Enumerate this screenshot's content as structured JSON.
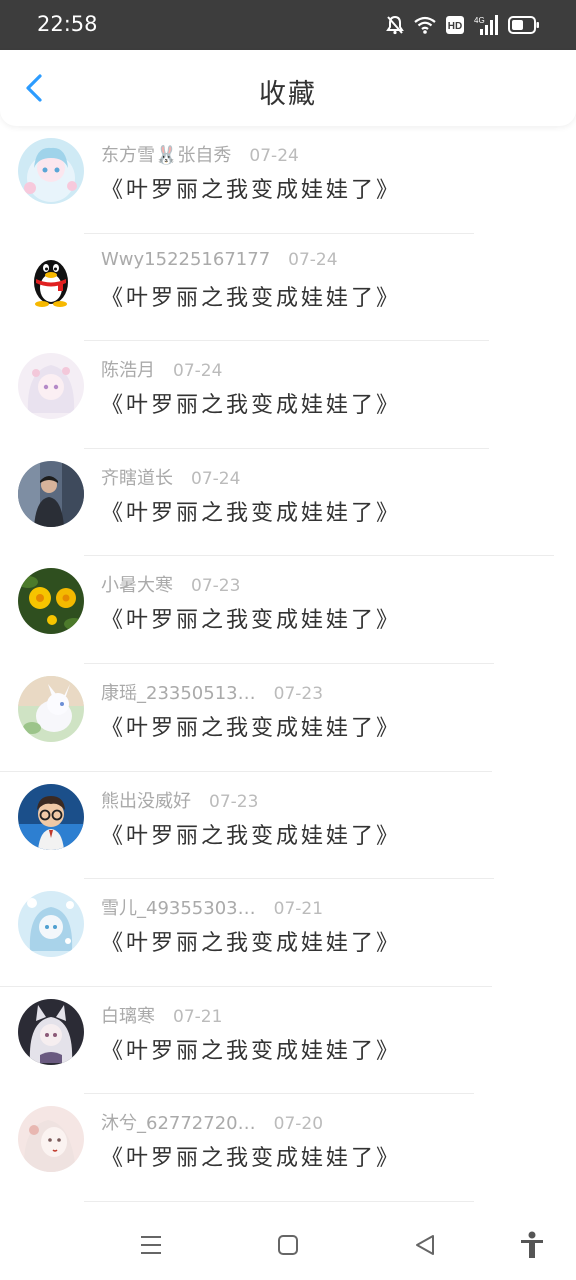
{
  "status_bar": {
    "time": "22:58",
    "hd_badge": "HD",
    "network": "4G"
  },
  "header": {
    "title": "收藏"
  },
  "items": [
    {
      "name": "东方雪🐰张自秀",
      "date": "07-24",
      "content": "《叶罗丽之我变成娃娃了》",
      "avatar": "anime-girl-blue"
    },
    {
      "name": "Wwy15225167177",
      "date": "07-24",
      "content": "《叶罗丽之我变成娃娃了》",
      "avatar": "penguin"
    },
    {
      "name": "陈浩月",
      "date": "07-24",
      "content": "《叶罗丽之我变成娃娃了》",
      "avatar": "anime-girl-pink"
    },
    {
      "name": "齐瞎道长",
      "date": "07-24",
      "content": "《叶罗丽之我变成娃娃了》",
      "avatar": "photo-boy"
    },
    {
      "name": "小暑大寒",
      "date": "07-23",
      "content": "《叶罗丽之我变成娃娃了》",
      "avatar": "yellow-flowers"
    },
    {
      "name": "康瑶_23350513…",
      "date": "07-23",
      "content": "《叶罗丽之我变成娃娃了》",
      "avatar": "white-creature"
    },
    {
      "name": "熊出没威好",
      "date": "07-23",
      "content": "《叶罗丽之我变成娃娃了》",
      "avatar": "cartoon-boy"
    },
    {
      "name": "雪儿_49355303…",
      "date": "07-21",
      "content": "《叶罗丽之我变成娃娃了》",
      "avatar": "anime-blue-sparkle"
    },
    {
      "name": "白璃寒",
      "date": "07-21",
      "content": "《叶罗丽之我变成娃娃了》",
      "avatar": "anime-catgirl"
    },
    {
      "name": "沐兮_62772720…",
      "date": "07-20",
      "content": "《叶罗丽之我变成娃娃了》",
      "avatar": "anime-pale-girl"
    }
  ],
  "colors": {
    "accent": "#2c9cff",
    "status_bar": "#3d3d3d",
    "text": "#333333",
    "meta": "#aaaaaa"
  },
  "nav_bar": {
    "icons": [
      "menu-icon",
      "home-square-icon",
      "back-triangle-icon",
      "accessibility-icon"
    ]
  }
}
